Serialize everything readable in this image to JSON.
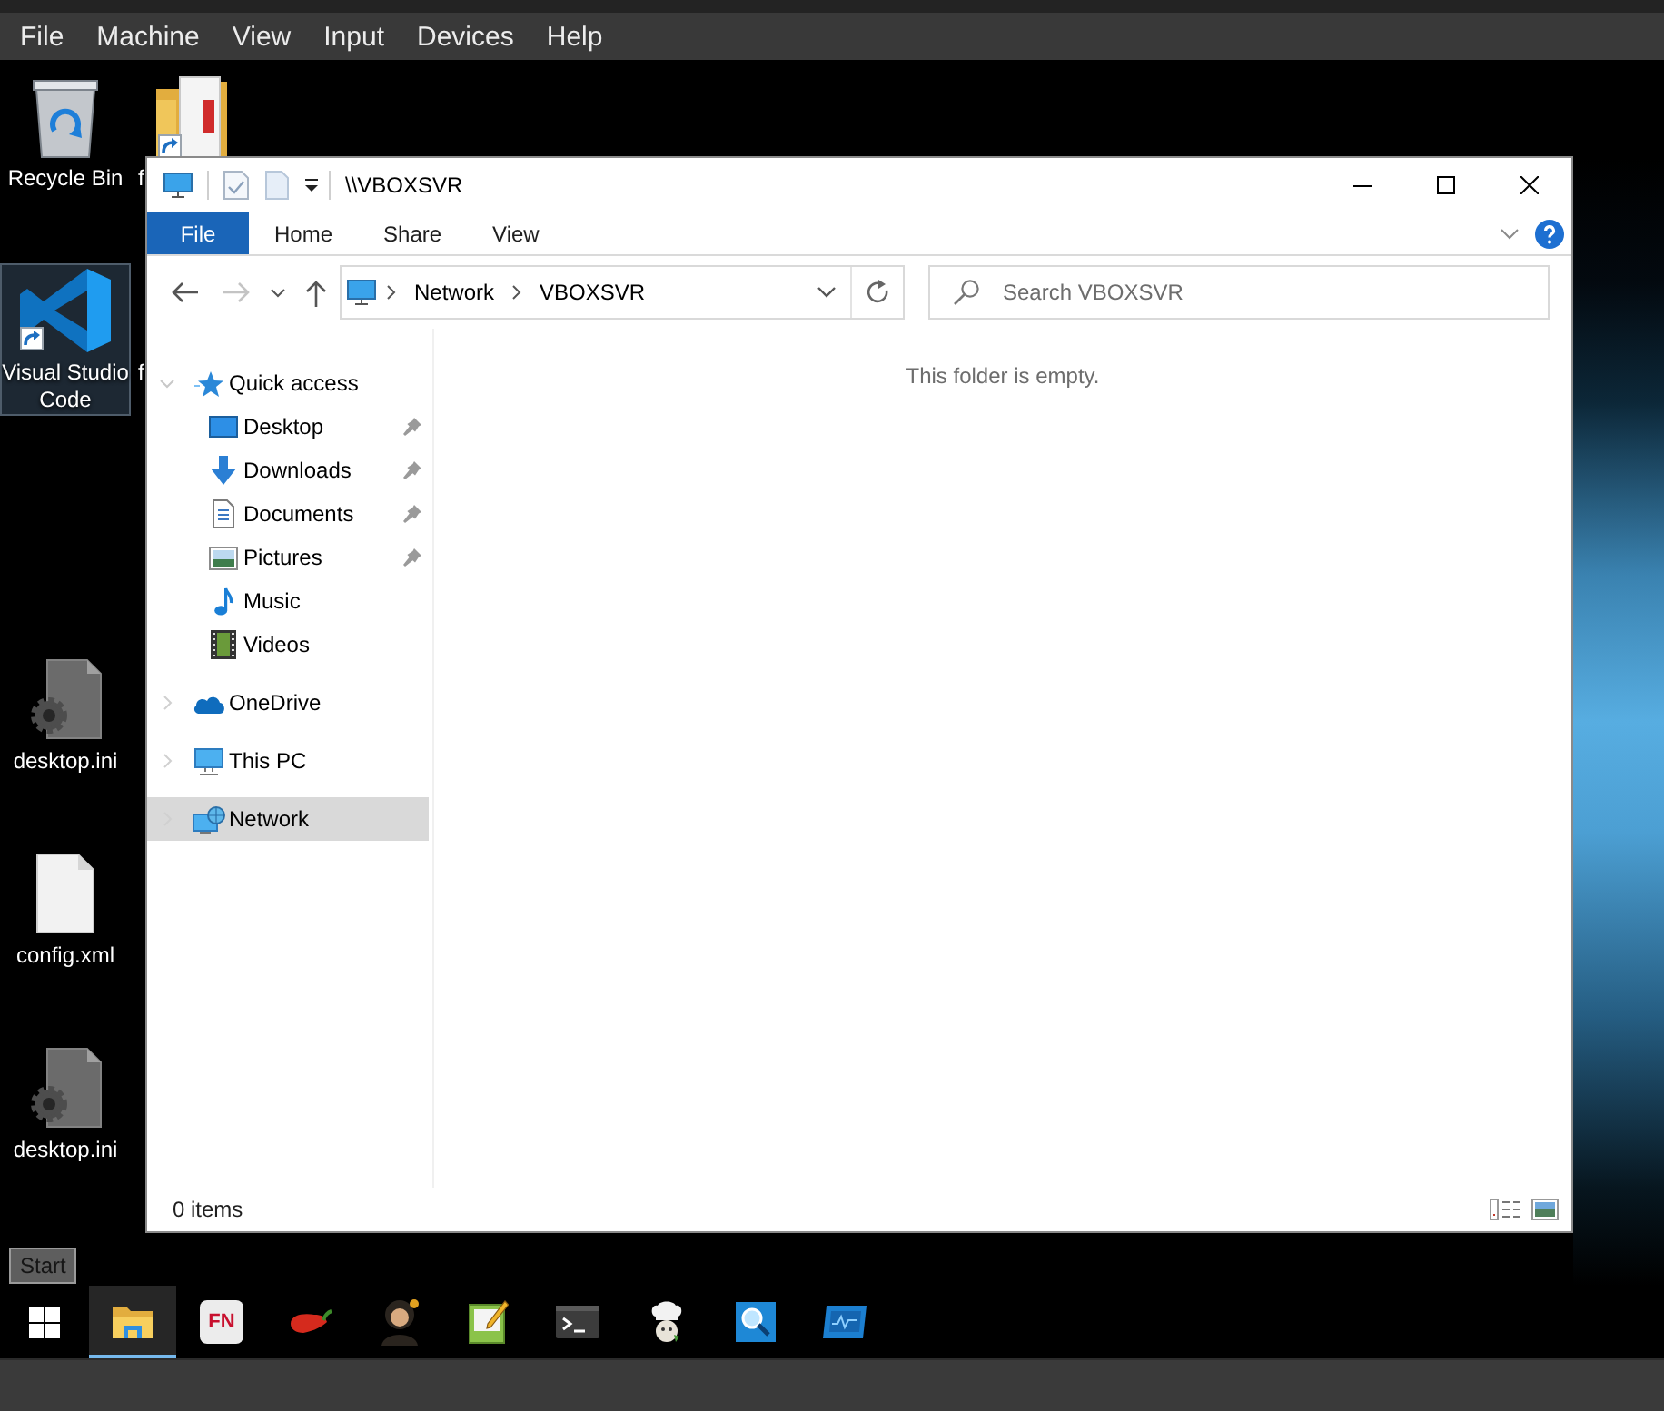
{
  "vm_menu": [
    "File",
    "Machine",
    "View",
    "Input",
    "Devices",
    "Help"
  ],
  "desktop": {
    "column_1": [
      {
        "label": "Recycle Bin",
        "kind": "recycle-bin",
        "shortcut": false,
        "selected": false
      },
      {
        "label": "Visual Studio Code",
        "kind": "vscode",
        "shortcut": true,
        "selected": true
      },
      {
        "label": "desktop.ini",
        "kind": "settings-file",
        "shortcut": false,
        "selected": false
      },
      {
        "label": "config.xml",
        "kind": "blank-file",
        "shortcut": false,
        "selected": false
      },
      {
        "label": "desktop.ini",
        "kind": "settings-file",
        "shortcut": false,
        "selected": false
      }
    ],
    "column_2": [
      {
        "label": "f",
        "kind": "folder",
        "shortcut": true,
        "selected": false
      },
      {
        "label": "f",
        "selected": false
      }
    ]
  },
  "explorer": {
    "title": "\\\\VBOXSVR",
    "file_tab": "File",
    "tabs": [
      "Home",
      "Share",
      "View"
    ],
    "nav_buttons": [
      {
        "kind": "back",
        "disabled": false
      },
      {
        "kind": "forward",
        "disabled": true
      },
      {
        "kind": "recent",
        "disabled": false
      },
      {
        "kind": "up",
        "disabled": false
      }
    ],
    "address": [
      "Network",
      "VBOXSVR"
    ],
    "search": {
      "placeholder": "Search VBOXSVR"
    },
    "navigation": [
      {
        "label": "Quick access",
        "kind": "quick-access",
        "expanded": true,
        "selected": false,
        "children": [
          {
            "label": "Desktop",
            "kind": "desktop",
            "pinned": true,
            "selected": false
          },
          {
            "label": "Downloads",
            "kind": "downloads",
            "pinned": true,
            "selected": false
          },
          {
            "label": "Documents",
            "kind": "documents",
            "pinned": true,
            "selected": false
          },
          {
            "label": "Pictures",
            "kind": "pictures",
            "pinned": true,
            "selected": false
          },
          {
            "label": "Music",
            "kind": "music",
            "pinned": false,
            "selected": false
          },
          {
            "label": "Videos",
            "kind": "videos",
            "pinned": false,
            "selected": false
          }
        ]
      },
      {
        "label": "OneDrive",
        "kind": "onedrive",
        "expanded": false,
        "selected": false
      },
      {
        "label": "This PC",
        "kind": "this-pc",
        "expanded": false,
        "selected": false
      },
      {
        "label": "Network",
        "kind": "network",
        "expanded": false,
        "selected": true
      }
    ],
    "empty_message": "This folder is empty.",
    "status_bar": {
      "item_count": "0 items"
    }
  },
  "taskbar": {
    "tooltip": "Start",
    "apps": [
      {
        "kind": "start",
        "selected": false
      },
      {
        "kind": "file-explorer",
        "selected": true
      },
      {
        "kind": "fn-app",
        "logo": "FN",
        "selected": false
      },
      {
        "kind": "pepper",
        "selected": false
      },
      {
        "kind": "portrait",
        "selected": false
      },
      {
        "kind": "notepad",
        "selected": false
      },
      {
        "kind": "terminal",
        "selected": false
      },
      {
        "kind": "chef",
        "selected": false
      },
      {
        "kind": "magnifier",
        "selected": false
      },
      {
        "kind": "monitor",
        "selected": false
      }
    ]
  }
}
